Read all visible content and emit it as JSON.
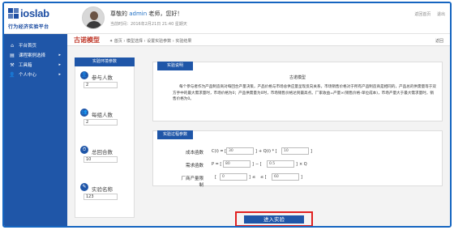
{
  "header": {
    "logo_text": "ioslab",
    "logo_sub": "行为经济实验平台",
    "greeting_prefix": "尊敬的",
    "user_name": "admin",
    "greeting_suffix": "老师，您好！",
    "last_login": "当前时间：2016年2月21日 21:40  星期天",
    "links": [
      "返回首页",
      "退出"
    ]
  },
  "sidebar": {
    "items": [
      {
        "icon": "home-icon",
        "glyph": "⌂",
        "label": "平台首页",
        "arrow": ""
      },
      {
        "icon": "book-icon",
        "glyph": "▤",
        "label": "课程案例选择",
        "arrow": "▸"
      },
      {
        "icon": "tools-icon",
        "glyph": "⚒",
        "label": "工具箱",
        "arrow": "▸"
      },
      {
        "icon": "user-icon",
        "glyph": "👤",
        "label": "个人中心",
        "arrow": "▸"
      }
    ]
  },
  "breadcrumb": {
    "title": "古诺模型",
    "path": "✦ 首页 › 模型选择 › 设置实验参数 › 实验结果",
    "back": "返回"
  },
  "env_panel": {
    "title": "实验环境参数",
    "params": [
      {
        "icon": "person-icon",
        "glyph": "👤",
        "label": "参与人数",
        "value": "2"
      },
      {
        "icon": "group-icon",
        "glyph": "👥",
        "label": "每组人数",
        "value": "2"
      },
      {
        "icon": "clock-icon",
        "glyph": "⏱",
        "label": "总回合数",
        "value": "10"
      },
      {
        "icon": "tag-icon",
        "glyph": "✎",
        "label": "实验名称",
        "value": "123"
      }
    ]
  },
  "intro_panel": {
    "title": "实验说明",
    "subtitle": "古诺模型",
    "text": "每个参与者作为产品制造商对每回合产量决策，产品价格与市场总供应量呈现反向关系，市场销售价格对于所有产品制造商是相同的，产品总的供需量等于双方手中的最大需求量时，市场价格为0；产品供需量为0时，市场销售价格达到最高点。厂家收益=产量×(销售价格-单位成本)，市场产量大于最大需求量时，销售价格为0。"
  },
  "process_panel": {
    "title": "实验过程参数",
    "rows": [
      {
        "label": "成本函数",
        "parts": [
          "C(i) = [",
          "]",
          " + Q(i) * [",
          "]"
        ],
        "values": [
          "30",
          "10"
        ]
      },
      {
        "label": "需求函数",
        "parts": [
          "P = [",
          "]",
          " − [",
          "]",
          " × Q"
        ],
        "values": [
          "80",
          "0.5"
        ]
      },
      {
        "label": "厂商产量限制",
        "parts": [
          "[",
          "]",
          " ≤ ",
          " ≤ [",
          "]"
        ],
        "values": [
          "0",
          "60"
        ]
      }
    ]
  },
  "actions": {
    "enter_label": "进入实验"
  },
  "colors": {
    "primary": "#1f56a8",
    "title_red": "#c0392b",
    "highlight_red": "#e02020"
  }
}
